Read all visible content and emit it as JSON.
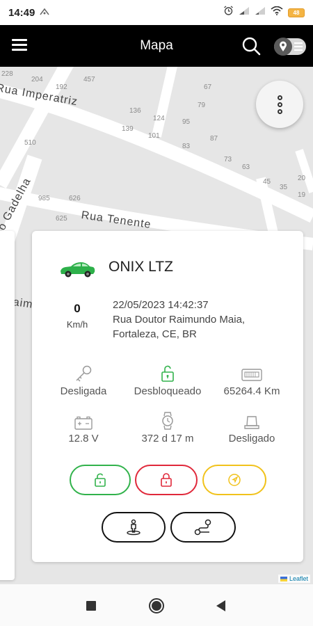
{
  "status_bar": {
    "time": "14:49",
    "battery": "48"
  },
  "app_bar": {
    "title": "Mapa"
  },
  "map": {
    "house_numbers": [
      "228",
      "204",
      "192",
      "457",
      "67",
      "136",
      "124",
      "79",
      "95",
      "139",
      "101",
      "83",
      "87",
      "510",
      "73",
      "63",
      "45",
      "35",
      "20",
      "985",
      "626",
      "19",
      "625"
    ],
    "streets": [
      "Rua Imperatriz",
      "Rua Tenente",
      "o Gadelha",
      "aim"
    ],
    "attribution": "Leaflet"
  },
  "vehicle": {
    "name": "ONIX LTZ",
    "speed": "0",
    "speed_unit": "Km/h",
    "datetime": "22/05/2023 14:42:37",
    "address_line1": "Rua Doutor Raimundo Maia,",
    "address_line2": "Fortaleza, CE, BR",
    "icon_color": "#2db04a"
  },
  "stats": [
    {
      "icon": "key-icon",
      "label": "Desligada"
    },
    {
      "icon": "unlock-icon",
      "label": "Desbloqueado"
    },
    {
      "icon": "odometer-icon",
      "label": "65264.4 Km"
    },
    {
      "icon": "battery-icon",
      "label": "12.8 V"
    },
    {
      "icon": "watch-icon",
      "label": "372 d 17 m"
    },
    {
      "icon": "engine-icon",
      "label": "Desligado"
    }
  ],
  "actions": {
    "unlock_color": "#31b24b",
    "lock_color": "#e0283a",
    "navigate_color": "#f1c21b"
  }
}
